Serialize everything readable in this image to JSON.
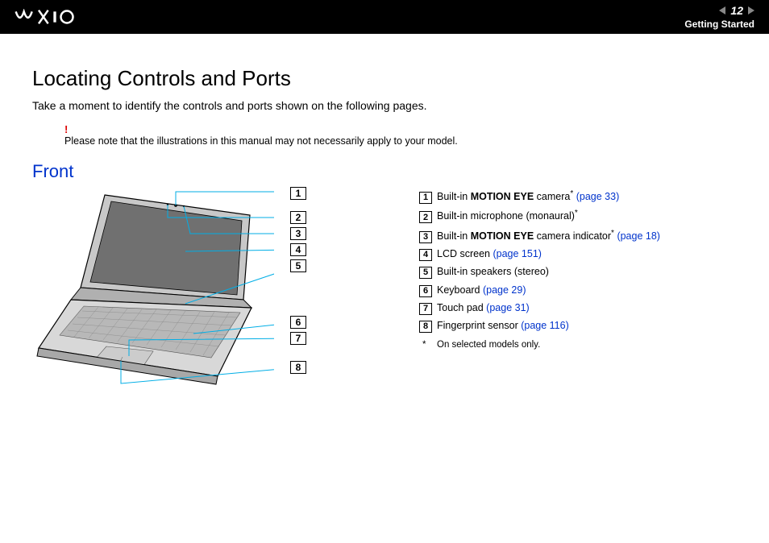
{
  "header": {
    "page_number": "12",
    "section": "Getting Started"
  },
  "page": {
    "title": "Locating Controls and Ports",
    "intro": "Take a moment to identify the controls and ports shown on the following pages.",
    "warning_mark": "!",
    "warning_text": "Please note that the illustrations in this manual may not necessarily apply to your model.",
    "subheading": "Front"
  },
  "callouts": {
    "n1": "1",
    "n2": "2",
    "n3": "3",
    "n4": "4",
    "n5": "5",
    "n6": "6",
    "n7": "7",
    "n8": "8"
  },
  "legend": {
    "items": [
      {
        "num": "1",
        "pre": "Built-in ",
        "strong": "MOTION EYE",
        "post": " camera",
        "ast": "*",
        "link": "(page 33)"
      },
      {
        "num": "2",
        "pre": "Built-in microphone (monaural)",
        "strong": "",
        "post": "",
        "ast": "*",
        "link": ""
      },
      {
        "num": "3",
        "pre": "Built-in ",
        "strong": "MOTION EYE",
        "post": " camera indicator",
        "ast": "*",
        "link": "(page 18)"
      },
      {
        "num": "4",
        "pre": "LCD screen ",
        "strong": "",
        "post": "",
        "ast": "",
        "link": "(page 151)"
      },
      {
        "num": "5",
        "pre": "Built-in speakers (stereo)",
        "strong": "",
        "post": "",
        "ast": "",
        "link": ""
      },
      {
        "num": "6",
        "pre": "Keyboard ",
        "strong": "",
        "post": "",
        "ast": "",
        "link": "(page 29)"
      },
      {
        "num": "7",
        "pre": "Touch pad ",
        "strong": "",
        "post": "",
        "ast": "",
        "link": "(page 31)"
      },
      {
        "num": "8",
        "pre": "Fingerprint sensor ",
        "strong": "",
        "post": "",
        "ast": "",
        "link": "(page 116)"
      }
    ],
    "footnote": "On selected models only."
  }
}
